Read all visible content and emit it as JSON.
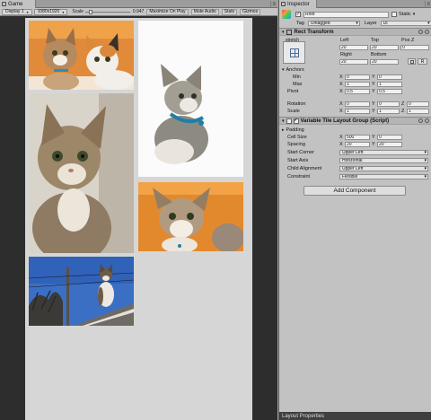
{
  "game": {
    "tab_label": "Game",
    "display_label": "Display 1",
    "resolution_label": "1080x1920",
    "scale_label": "Scale",
    "scale_value": "0.947",
    "scale_fraction": 0.1,
    "maximize_label": "Maximize On Play",
    "mute_label": "Mute Audio",
    "stats_label": "Stats",
    "gizmos_label": "Gizmos"
  },
  "inspector": {
    "tab_label": "Inspector",
    "object_name": "Root",
    "static_label": "Static",
    "tag_label": "Tag",
    "tag_value": "Untagged",
    "layer_label": "Layer",
    "layer_value": "UI",
    "rect_transform": {
      "title": "Rect Transform",
      "stretch_label": "stretch",
      "col_left": "Left",
      "col_top": "Top",
      "col_posz": "Pos Z",
      "left": "20",
      "top": "20",
      "posz": "0",
      "col_right": "Right",
      "col_bottom": "Bottom",
      "right": "20",
      "bottom": "20",
      "r_button": "R",
      "anchors_label": "Anchors",
      "min_label": "Min",
      "max_label": "Max",
      "min_x": "0",
      "min_y": "0",
      "max_x": "1",
      "max_y": "1",
      "pivot_label": "Pivot",
      "pivot_x": "0.5",
      "pivot_y": "0.5",
      "rotation_label": "Rotation",
      "rot_x": "0",
      "rot_y": "0",
      "rot_z": "0",
      "scale_label": "Scale",
      "scale_x": "1",
      "scale_y": "1",
      "scale_z": "1",
      "x": "X",
      "y": "Y",
      "z": "Z"
    },
    "layout_group": {
      "title": "Variable Tile Layout Group (Script)",
      "padding_label": "Padding",
      "cell_size_label": "Cell Size",
      "cell_x": "500",
      "cell_y": "0",
      "spacing_label": "Spacing",
      "spacing_x": "20",
      "spacing_y": "20",
      "start_corner_label": "Start Corner",
      "start_corner_value": "Upper Left",
      "start_axis_label": "Start Axis",
      "start_axis_value": "Horizontal",
      "child_alignment_label": "Child Alignment",
      "child_alignment_value": "Upper Left",
      "constraint_label": "Constraint",
      "constraint_value": "Flexible"
    },
    "add_component_label": "Add Component",
    "bottom_label": "Layout Properties"
  },
  "colors": {
    "viewport_bg": "#d6d6d6",
    "editor_dark": "#2d2d2d",
    "inspector_bg": "#c2c2c2"
  }
}
